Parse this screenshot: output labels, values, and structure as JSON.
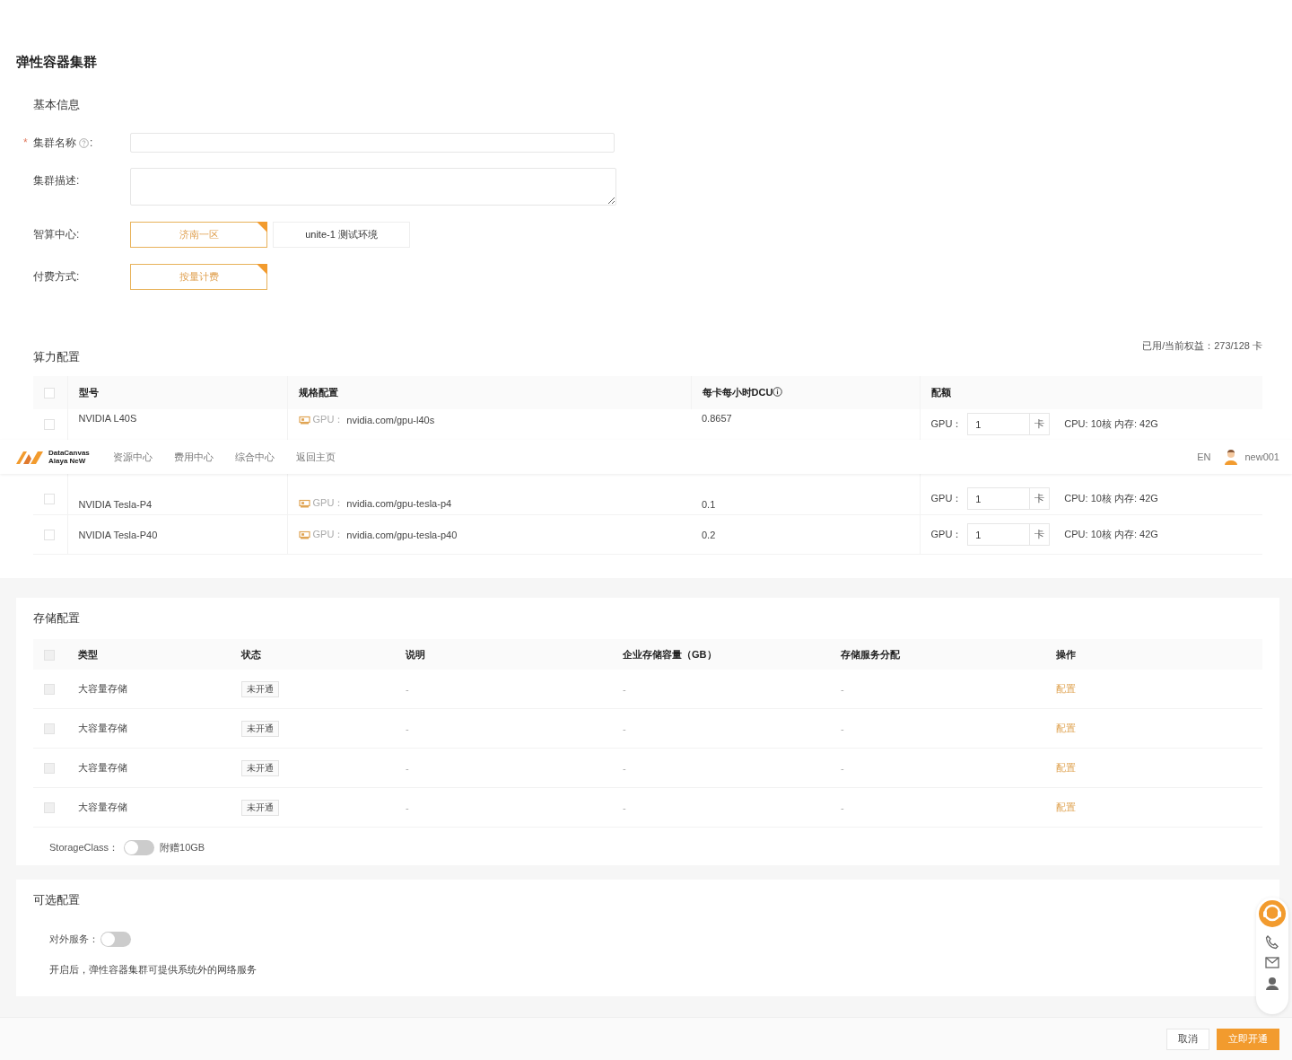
{
  "page_title": "弹性容器集群",
  "basic_info": {
    "title": "基本信息",
    "name_field": {
      "required": true,
      "required_mark": "*",
      "label": "集群名称",
      "suffix": ":"
    },
    "desc_field": {
      "label": "集群描述:"
    },
    "center": {
      "label": "智算中心:",
      "options": [
        {
          "label": "济南一区",
          "selected": true
        },
        {
          "label": "unite-1 测试环境",
          "selected": false
        }
      ]
    },
    "billing": {
      "label": "付费方式:",
      "options": [
        {
          "label": "按量计费",
          "selected": true
        }
      ]
    }
  },
  "compute": {
    "title": "算力配置",
    "summary": "已用/当前权益：273/128 卡",
    "select_all_checked": false,
    "columns": [
      "型号",
      "规格配置",
      "每卡每小时DCU",
      "配额"
    ],
    "rows": [
      {
        "checked": false,
        "model": "NVIDIA L40S",
        "spec_label": "GPU：",
        "spec": "nvidia.com/gpu-l40s",
        "dcu": "0.8657",
        "quota_label": "GPU：",
        "quota": "1",
        "unit": "卡",
        "resources": "CPU: 10核 内存: 42G"
      },
      {
        "checked": false,
        "model": "NVIDIA Tesla-P4",
        "spec_label": "GPU：",
        "spec": "nvidia.com/gpu-tesla-p4",
        "dcu": "0.1",
        "quota_label": "GPU：",
        "quota": "1",
        "unit": "卡",
        "resources": "CPU: 10核 内存: 42G"
      },
      {
        "checked": false,
        "model": "NVIDIA Tesla-P40",
        "spec_label": "GPU：",
        "spec": "nvidia.com/gpu-tesla-p40",
        "dcu": "0.2",
        "quota_label": "GPU：",
        "quota": "1",
        "unit": "卡",
        "resources": "CPU: 10核 内存: 42G"
      }
    ]
  },
  "nav": {
    "logo_line_1": "DataCanvas",
    "logo_line_2": "Alaya NeW",
    "items": [
      "资源中心",
      "费用中心",
      "综合中心",
      "返回主页"
    ],
    "language": "EN",
    "user": "new001"
  },
  "storage": {
    "title": "存储配置",
    "select_all_checked": false,
    "columns": [
      "类型",
      "状态",
      "说明",
      "企业存储容量（GB）",
      "存储服务分配",
      "操作"
    ],
    "rows": [
      {
        "checked": false,
        "disabled": true,
        "type": "大容量存储",
        "status": "未开通",
        "description": "-",
        "capacity": "-",
        "allocation": "-",
        "action": "配置"
      },
      {
        "checked": false,
        "disabled": true,
        "type": "大容量存储",
        "status": "未开通",
        "description": "-",
        "capacity": "-",
        "allocation": "-",
        "action": "配置"
      },
      {
        "checked": false,
        "disabled": true,
        "type": "大容量存储",
        "status": "未开通",
        "description": "-",
        "capacity": "-",
        "allocation": "-",
        "action": "配置"
      },
      {
        "checked": false,
        "disabled": true,
        "type": "大容量存储",
        "status": "未开通",
        "description": "-",
        "capacity": "-",
        "allocation": "-",
        "action": "配置"
      }
    ],
    "storage_class": {
      "label": "StorageClass：",
      "on": false,
      "note": "附赠10GB"
    }
  },
  "optional": {
    "title": "可选配置",
    "toggle": {
      "label": "对外服务：",
      "on": false
    },
    "note": "开启后，弹性容器集群可提供系统外的网络服务"
  },
  "footer": {
    "buttons": [
      {
        "label": "取消",
        "kind": "secondary"
      },
      {
        "label": "立即开通",
        "kind": "primary"
      }
    ]
  }
}
